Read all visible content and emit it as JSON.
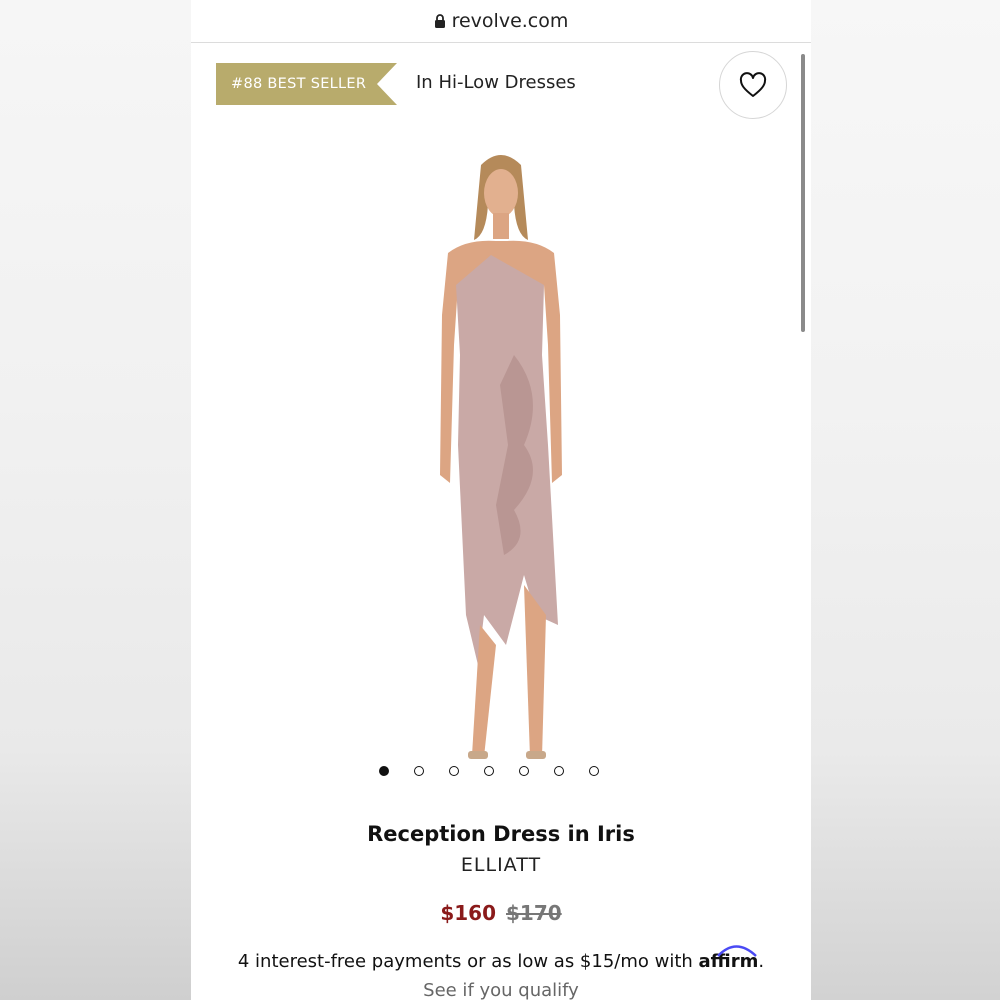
{
  "browser": {
    "url": "revolve.com",
    "lock_icon": "lock-icon"
  },
  "product": {
    "badge": "#88 BEST SELLER",
    "category": "In Hi-Low Dresses",
    "favorite_icon": "heart-icon",
    "title": "Reception Dress in Iris",
    "brand": "ELLIATT",
    "price_sale": "$160",
    "price_original": "$170",
    "image_count": 7,
    "active_image_index": 0
  },
  "financing": {
    "text": "4 interest-free payments or as low as $15/mo with ",
    "provider": "affirm",
    "suffix": ".",
    "link": "See if you qualify"
  },
  "colors": {
    "badge_bg": "#b8ab6c",
    "sale_price": "#8a1a1a",
    "dress": "#c9a9a6"
  }
}
